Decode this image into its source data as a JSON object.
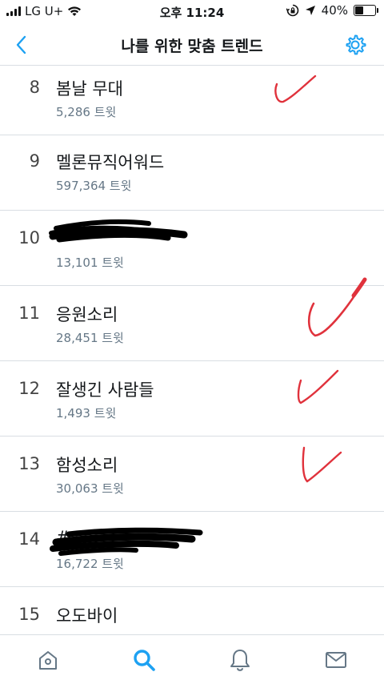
{
  "status_bar": {
    "carrier": "LG U+",
    "time": "오후 11:24",
    "battery": "40%",
    "battery_level": 0.4
  },
  "header": {
    "title": "나를 위한 맞춤 트렌드",
    "back_icon": "chevron-left-icon",
    "settings_icon": "gear-icon",
    "accent_color": "#1da1f2"
  },
  "trends": [
    {
      "rank": "8",
      "name": "봄날 무대",
      "count": "5,286 트윗"
    },
    {
      "rank": "9",
      "name": "멜론뮤직어워드",
      "count": "597,364 트윗"
    },
    {
      "rank": "10",
      "name": "",
      "count": "13,101 트윗"
    },
    {
      "rank": "11",
      "name": "응원소리",
      "count": "28,451 트윗"
    },
    {
      "rank": "12",
      "name": "잘생긴 사람들",
      "count": "1,493 트윗"
    },
    {
      "rank": "13",
      "name": "함성소리",
      "count": "30,063 트윗"
    },
    {
      "rank": "14",
      "name": "#",
      "count": "16,722 트윗"
    },
    {
      "rank": "15",
      "name": "오도바이",
      "count": ""
    }
  ],
  "tab_bar": {
    "tabs": [
      {
        "icon": "home-icon",
        "active": false
      },
      {
        "icon": "search-icon",
        "active": true
      },
      {
        "icon": "bell-icon",
        "active": false
      },
      {
        "icon": "mail-icon",
        "active": false
      }
    ]
  }
}
